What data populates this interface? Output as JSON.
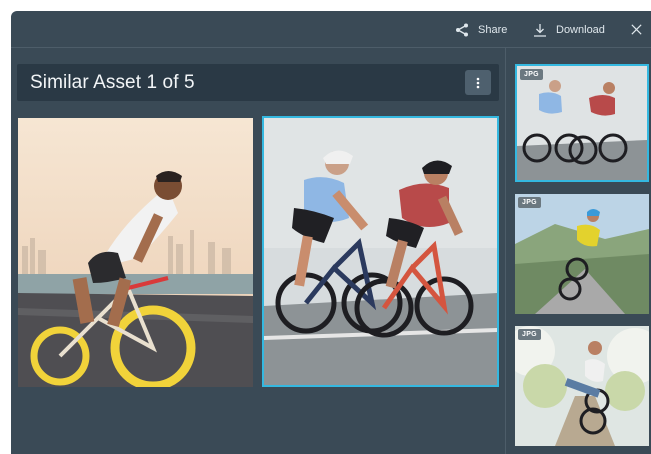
{
  "toolbar": {
    "share_label": "Share",
    "download_label": "Download"
  },
  "viewer": {
    "title": "Similar Asset 1 of 5"
  },
  "thumbnails": [
    {
      "badge": "JPG",
      "selected": true
    },
    {
      "badge": "JPG",
      "selected": false
    },
    {
      "badge": "JPG",
      "selected": false
    }
  ],
  "colors": {
    "panel_bg": "#3a4a56",
    "title_bg": "#2a3945",
    "accent": "#34b8e0",
    "text": "#dfe7ec"
  },
  "icons": {
    "share": "share-icon",
    "download": "download-icon",
    "close": "close-icon",
    "more": "more-vertical-icon"
  }
}
